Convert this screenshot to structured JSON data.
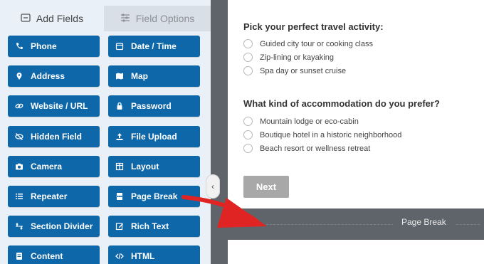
{
  "tabs": {
    "add_fields": "Add Fields",
    "field_options": "Field Options",
    "add_fields_icon": "grid-icon",
    "field_options_icon": "sliders-icon"
  },
  "fields": [
    {
      "label": "Phone",
      "icon": "phone-icon"
    },
    {
      "label": "Date / Time",
      "icon": "calendar-icon"
    },
    {
      "label": "Address",
      "icon": "map-pin-icon"
    },
    {
      "label": "Map",
      "icon": "map-icon"
    },
    {
      "label": "Website / URL",
      "icon": "link-icon"
    },
    {
      "label": "Password",
      "icon": "lock-icon"
    },
    {
      "label": "Hidden Field",
      "icon": "eye-slash-icon"
    },
    {
      "label": "File Upload",
      "icon": "upload-icon"
    },
    {
      "label": "Camera",
      "icon": "camera-icon"
    },
    {
      "label": "Layout",
      "icon": "layout-icon"
    },
    {
      "label": "Repeater",
      "icon": "list-icon"
    },
    {
      "label": "Page Break",
      "icon": "page-break-icon"
    },
    {
      "label": "Section Divider",
      "icon": "arrows-vertical-icon"
    },
    {
      "label": "Rich Text",
      "icon": "edit-icon"
    },
    {
      "label": "Content",
      "icon": "content-icon"
    },
    {
      "label": "HTML",
      "icon": "code-icon"
    }
  ],
  "form": {
    "q1": {
      "title": "Pick your perfect travel activity:",
      "options": [
        "Guided city tour or cooking class",
        "Zip-lining or kayaking",
        "Spa day or sunset cruise"
      ]
    },
    "q2": {
      "title": "What kind of accommodation do you prefer?",
      "options": [
        "Mountain lodge or eco-cabin",
        "Boutique hotel in a historic neighborhood",
        "Beach resort or wellness retreat"
      ]
    },
    "next_label": "Next",
    "page_break_label": "Page Break"
  },
  "colors": {
    "field_button": "#0e67a9",
    "arrow": "#e02424",
    "page_break_bar": "#5f646b",
    "panel_bg": "#e9f0f7"
  }
}
